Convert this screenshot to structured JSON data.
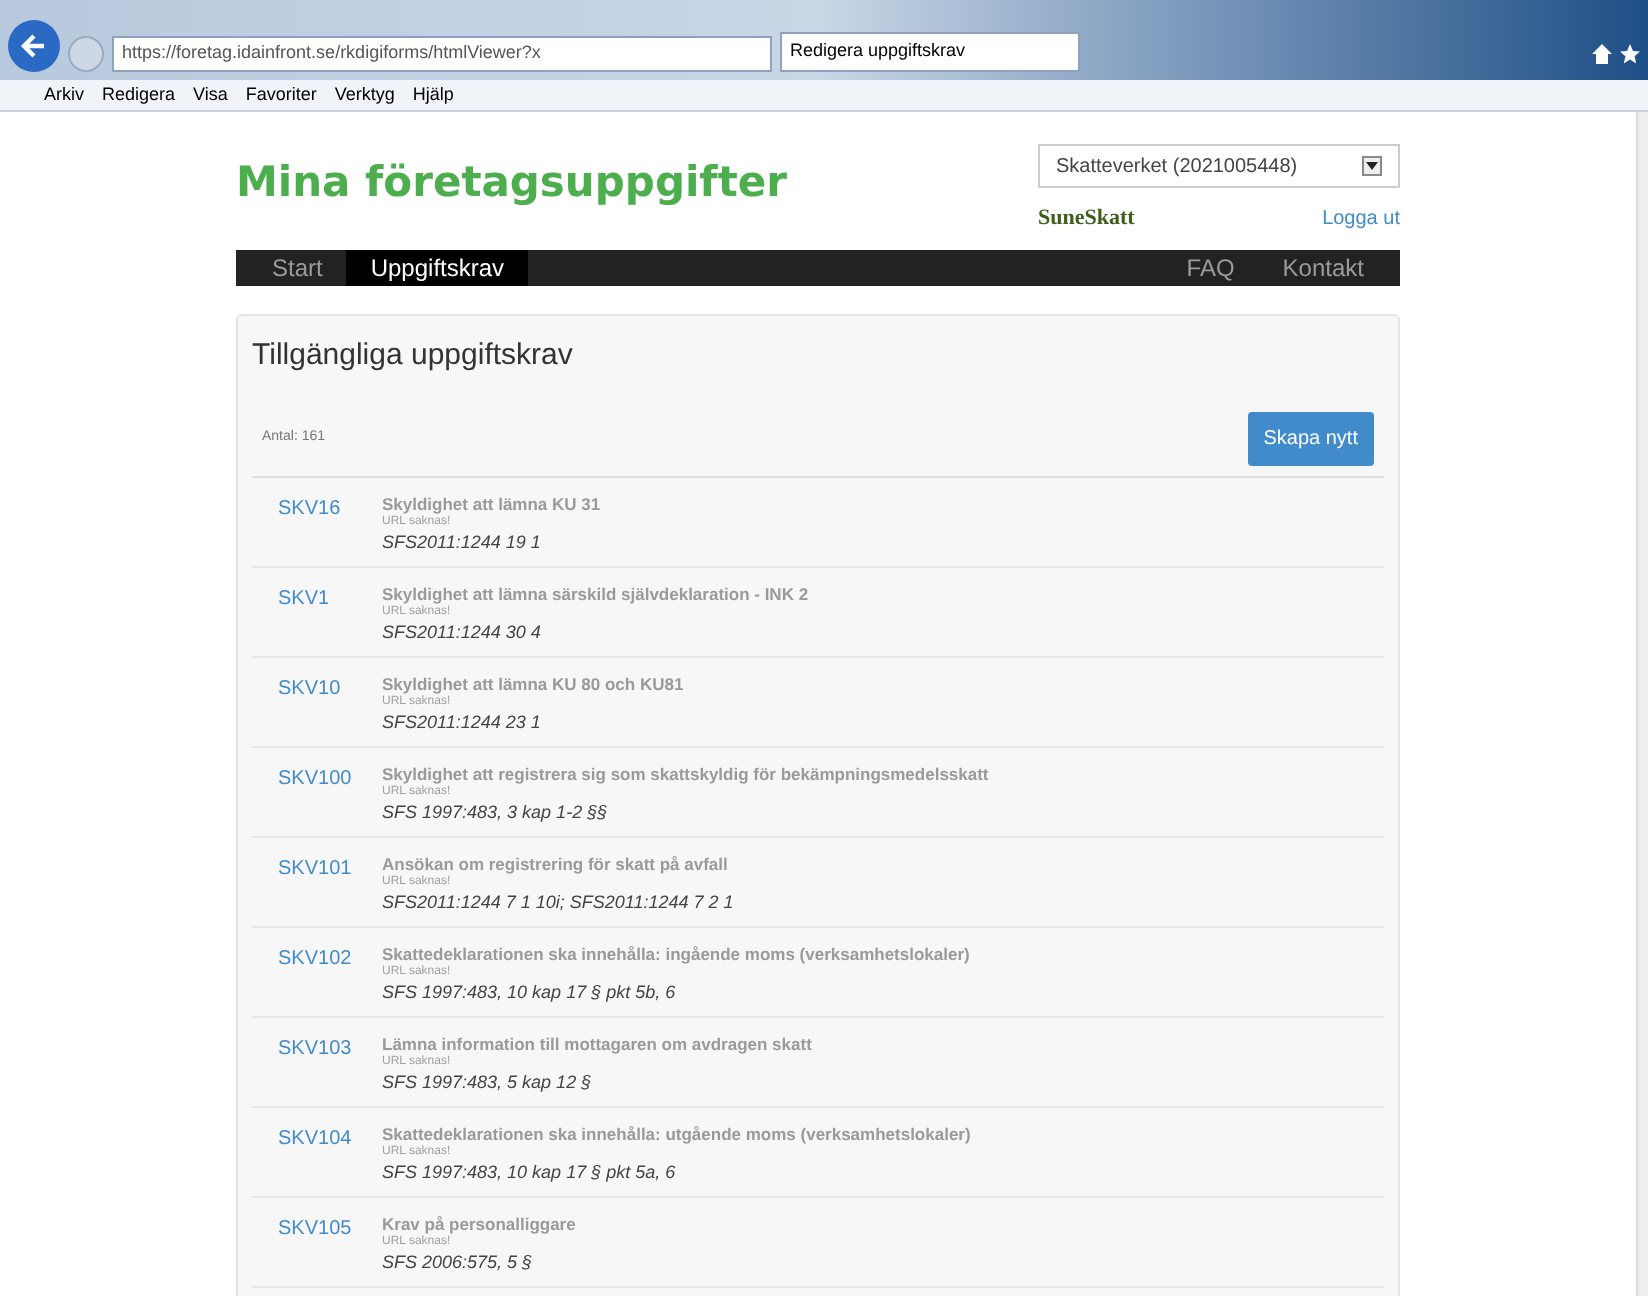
{
  "browser": {
    "url": "https://foretag.idainfront.se/rkdigiforms/htmlViewer?x",
    "tab_title": "Redigera uppgiftskrav",
    "menu": [
      "Arkiv",
      "Redigera",
      "Visa",
      "Favoriter",
      "Verktyg",
      "Hjälp"
    ]
  },
  "header": {
    "title": "Mina företagsuppgifter",
    "org_select": "Skatteverket (2021005448)",
    "user": "SuneSkatt",
    "logout": "Logga ut"
  },
  "nav": {
    "left": [
      {
        "label": "Start",
        "selected": false
      },
      {
        "label": "Uppgiftskrav",
        "selected": true
      }
    ],
    "right": [
      {
        "label": "FAQ",
        "selected": false
      },
      {
        "label": "Kontakt",
        "selected": false
      }
    ]
  },
  "panel": {
    "title": "Tillgängliga uppgiftskrav",
    "count": "Antal: 161",
    "create_button": "Skapa nytt",
    "rows": [
      {
        "code": "SKV16",
        "name": "Skyldighet att lämna KU 31",
        "url": "URL saknas!",
        "ref": "SFS2011:1244 19 1"
      },
      {
        "code": "SKV1",
        "name": "Skyldighet att lämna särskild självdeklaration - INK 2",
        "url": "URL saknas!",
        "ref": "SFS2011:1244 30 4"
      },
      {
        "code": "SKV10",
        "name": "Skyldighet att lämna KU 80 och KU81",
        "url": "URL saknas!",
        "ref": "SFS2011:1244 23 1"
      },
      {
        "code": "SKV100",
        "name": "Skyldighet att registrera sig som skattskyldig för bekämpningsmedelsskatt",
        "url": "URL saknas!",
        "ref": "SFS 1997:483, 3 kap 1-2 §§"
      },
      {
        "code": "SKV101",
        "name": "Ansökan om registrering för skatt på avfall",
        "url": "URL saknas!",
        "ref": "SFS2011:1244 7 1 10i; SFS2011:1244 7 2 1"
      },
      {
        "code": "SKV102",
        "name": "Skattedeklarationen ska innehålla: ingående moms (verksamhetslokaler)",
        "url": "URL saknas!",
        "ref": "SFS 1997:483, 10 kap 17 § pkt 5b, 6"
      },
      {
        "code": "SKV103",
        "name": "Lämna information till mottagaren om avdragen skatt",
        "url": "URL saknas!",
        "ref": "SFS 1997:483, 5 kap 12 §"
      },
      {
        "code": "SKV104",
        "name": "Skattedeklarationen ska innehålla: utgående moms (verksamhetslokaler)",
        "url": "URL saknas!",
        "ref": "SFS 1997:483, 10 kap 17 § pkt 5a, 6"
      },
      {
        "code": "SKV105",
        "name": "Krav på personalliggare",
        "url": "URL saknas!",
        "ref": "SFS 2006:575, 5 §"
      }
    ]
  }
}
